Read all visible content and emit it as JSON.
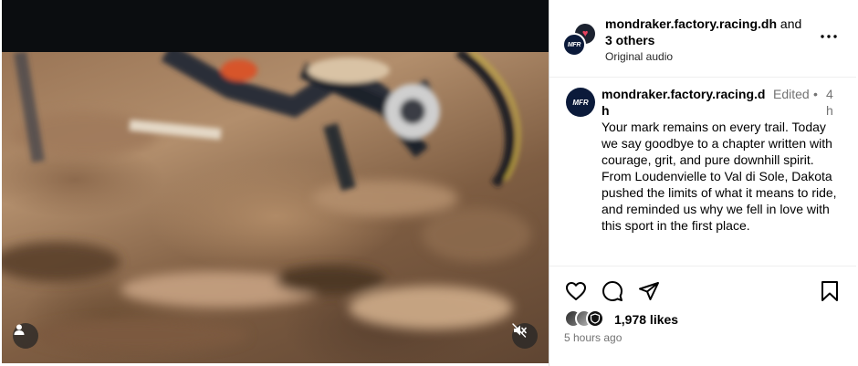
{
  "post": {
    "header": {
      "username": "mondraker.factory.racing.dh",
      "connector": " and",
      "others": "3 others",
      "audio": "Original audio",
      "avatar_text": "MFR"
    },
    "caption": {
      "username": "mondraker.factory.racing.dh",
      "edited": "Edited",
      "dot": "•",
      "time": "4h",
      "avatar_text": "MFR",
      "text": "Your mark remains on every trail. Today we say goodbye to a chapter written with courage, grit, and pure downhill spirit. From  Loudenvielle to Val di Sole, Dakota pushed the limits of what it means to ride, and reminded us why we fell in love with this sport in the first place."
    },
    "likes": {
      "count_label": "1,978 likes"
    },
    "posted_ago": "5 hours ago"
  },
  "icons": {
    "more": "more-options-icon",
    "like": "heart-icon",
    "comment": "comment-icon",
    "share": "paper-plane-icon",
    "save": "bookmark-icon",
    "user_tag": "user-icon",
    "mute": "speaker-muted-icon"
  },
  "colors": {
    "video_letterbox": "#0b0d10",
    "secondary_text": "#737373",
    "divider": "#efefef",
    "accent_heart": "#e8425e"
  }
}
